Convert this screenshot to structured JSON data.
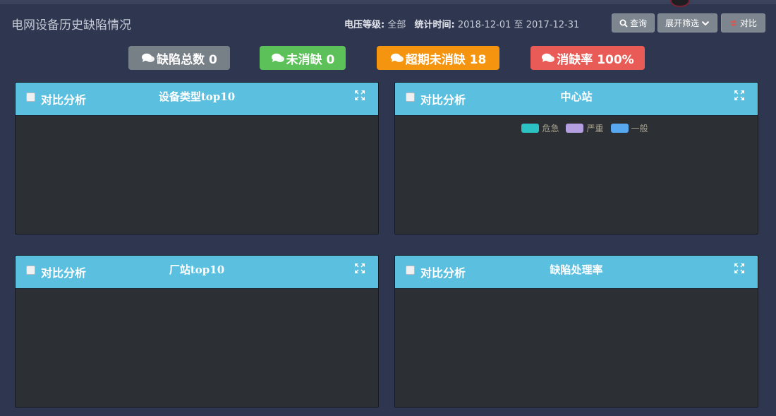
{
  "page": {
    "title": "电网设备历史缺陷情况"
  },
  "filters": {
    "voltage_label": "电压等级:",
    "voltage_value": "全部",
    "period_label": "统计时间:",
    "period_start": "2018-12-01",
    "period_sep": "至",
    "period_end": "2017-12-31"
  },
  "toolbar": {
    "query_label": "查询",
    "expand_label": "展开筛选",
    "compare_label": "对比"
  },
  "badges": [
    {
      "label": "缺陷总数 0",
      "color": "#777f87"
    },
    {
      "label": "未消缺 0",
      "color": "#5dc15a"
    },
    {
      "label": "超期未消缺 18",
      "color": "#f5940f"
    },
    {
      "label": "消缺率 100%",
      "color": "#e85b57"
    }
  ],
  "panels": [
    {
      "compare_label": "对比分析",
      "title": "设备类型top10"
    },
    {
      "compare_label": "对比分析",
      "title": "中心站",
      "legend": [
        {
          "name": "危急",
          "color": "#2bc3c3"
        },
        {
          "name": "严重",
          "color": "#b4a0e0"
        },
        {
          "name": "一般",
          "color": "#58a8ef"
        }
      ]
    },
    {
      "compare_label": "对比分析",
      "title": "厂站top10"
    },
    {
      "compare_label": "对比分析",
      "title": "缺陷处理率"
    }
  ],
  "icons": {
    "badge": "comments-icon",
    "query": "search-icon",
    "expand": "chevron-down-icon",
    "compare": "compare-icon",
    "panel_expand": "fullscreen-icon"
  }
}
